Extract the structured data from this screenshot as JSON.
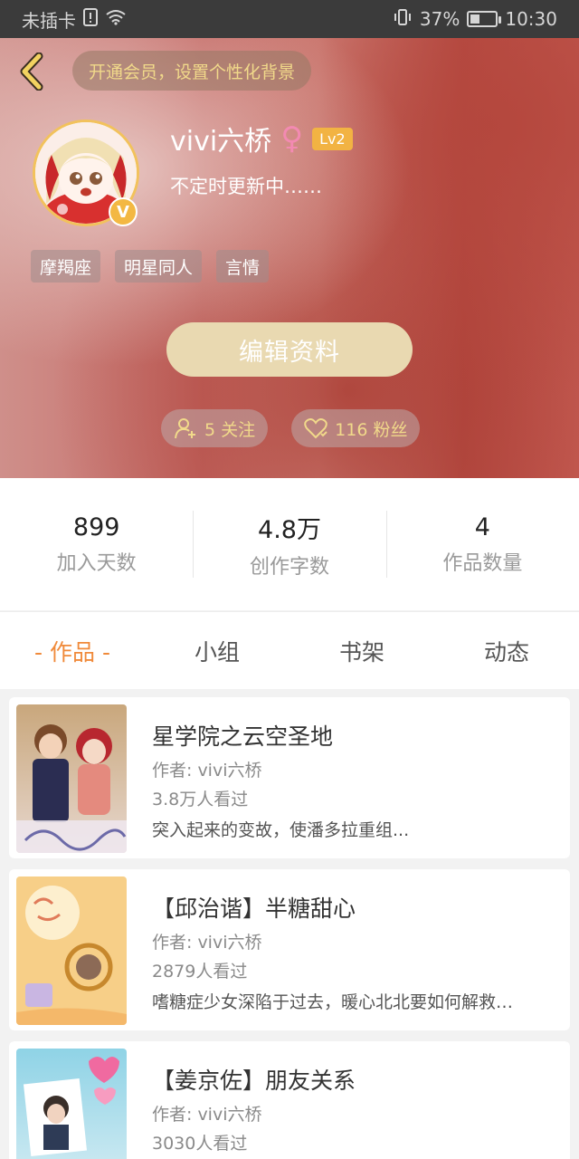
{
  "status_bar": {
    "carrier": "未插卡",
    "battery": "37%",
    "time": "10:30",
    "icons": [
      "sim-alert-icon",
      "wifi-icon",
      "vibrate-icon",
      "battery-icon"
    ]
  },
  "header": {
    "back_icon": "chevron-left-icon",
    "vip_promo": "开通会员，设置个性化背景",
    "username": "vivi六桥",
    "gender_symbol": "♀",
    "level": "Lv2",
    "badge_letter": "V",
    "signature": "不定时更新中……",
    "tags": [
      "摩羯座",
      "明星同人",
      "言情"
    ],
    "edit_button": "编辑资料",
    "following": "5 关注",
    "followers": "116 粉丝"
  },
  "stats": [
    {
      "value": "899",
      "label": "加入天数"
    },
    {
      "value": "4.8万",
      "label": "创作字数"
    },
    {
      "value": "4",
      "label": "作品数量"
    }
  ],
  "tabs": [
    {
      "label": "- 作品 -",
      "active": true
    },
    {
      "label": "小组",
      "active": false
    },
    {
      "label": "书架",
      "active": false
    },
    {
      "label": "动态",
      "active": false
    }
  ],
  "works": [
    {
      "title": "星学院之云空圣地",
      "author": "作者: vivi六桥",
      "views": "3.8万人看过",
      "desc": "突入起来的变故，使潘多拉重组..."
    },
    {
      "title": "【邱治谐】半糖甜心",
      "author": "作者: vivi六桥",
      "views": "2879人看过",
      "desc": "嗜糖症少女深陷于过去，暖心北北要如何解救…"
    },
    {
      "title": "【姜京佐】朋友关系",
      "author": "作者: vivi六桥",
      "views": "3030人看过",
      "desc": ""
    }
  ],
  "colors": {
    "accent": "#f08a3a",
    "gold": "#f1d98a",
    "edit_button": "#e9d9b1"
  }
}
